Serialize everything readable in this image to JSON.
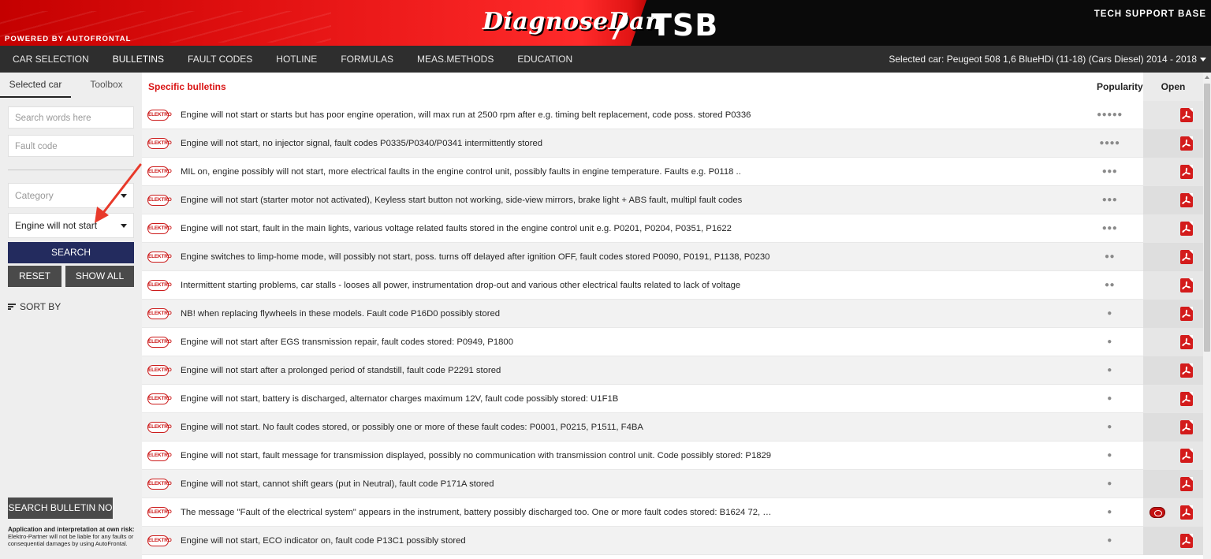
{
  "header": {
    "powered_by": "POWERED BY AUTOFRONTAL",
    "brand": "DiagnoseDan",
    "logo_tsb": "TSB",
    "tagline": "TECH SUPPORT BASE"
  },
  "nav": {
    "tabs": [
      "CAR SELECTION",
      "BULLETINS",
      "FAULT CODES",
      "HOTLINE",
      "FORMULAS",
      "MEAS.METHODS",
      "EDUCATION"
    ],
    "active": "BULLETINS",
    "selected_car": "Selected car: Peugeot 508 1,6 BlueHDi (11-18) (Cars Diesel) 2014 - 2018"
  },
  "sidebar": {
    "tab_selected_car": "Selected car",
    "tab_toolbox": "Toolbox",
    "search_placeholder": "Search words here",
    "faultcode_placeholder": "Fault code",
    "category_placeholder": "Category",
    "subcategory_value": "Engine will not start",
    "search_button": "SEARCH",
    "reset_button": "RESET",
    "showall_button": "SHOW ALL",
    "sort_by": "SORT BY",
    "search_bulletin_button": "SEARCH BULLETIN NO",
    "disclaimer_title": "Application and interpretation at own risk:",
    "disclaimer_text": "Elektro-Partner will not be liable for any faults or consequential damages by using AutoFrontal."
  },
  "table": {
    "title": "Specific bulletins",
    "col_popularity": "Popularity",
    "col_open": "Open",
    "source_badge": "ELEKTRO",
    "rows": [
      {
        "title": "Engine will not start or starts but has poor engine operation, will max run at 2500 rpm after e.g. timing belt replacement, code poss. stored P0336",
        "popularity": "●●●●●",
        "extra_icon": false
      },
      {
        "title": "Engine will not start, no injector signal, fault codes P0335/P0340/P0341 intermittently stored",
        "popularity": "●●●●",
        "extra_icon": false
      },
      {
        "title": "MIL on, engine possibly will not start, more electrical faults in the engine control unit, possibly faults in engine temperature. Faults e.g. P0118 ..",
        "popularity": "●●●",
        "extra_icon": false
      },
      {
        "title": "Engine will not start (starter motor not activated), Keyless start button not working, side-view mirrors, brake light + ABS fault, multipl fault codes",
        "popularity": "●●●",
        "extra_icon": false
      },
      {
        "title": "Engine will not start, fault in the main lights, various voltage related faults stored in the engine control unit e.g. P0201, P0204, P0351, P1622",
        "popularity": "●●●",
        "extra_icon": false
      },
      {
        "title": "Engine switches to limp-home mode, will possibly not start, poss. turns off delayed after ignition OFF, fault codes stored P0090, P0191, P1138, P0230",
        "popularity": "●●",
        "extra_icon": false
      },
      {
        "title": "Intermittent starting problems, car stalls - looses all power, instrumentation drop-out and various other electrical faults related to lack of voltage",
        "popularity": "●●",
        "extra_icon": false
      },
      {
        "title": "NB! when replacing flywheels in these models. Fault code P16D0 possibly stored",
        "popularity": "●",
        "extra_icon": false
      },
      {
        "title": "Engine will not start after EGS transmission repair, fault codes stored: P0949, P1800",
        "popularity": "●",
        "extra_icon": false
      },
      {
        "title": "Engine will not start after a prolonged period of standstill, fault code P2291 stored",
        "popularity": "●",
        "extra_icon": false
      },
      {
        "title": "Engine will not start, battery is discharged, alternator charges maximum 12V, fault code possibly stored: U1F1B",
        "popularity": "●",
        "extra_icon": false
      },
      {
        "title": "Engine will not start. No fault codes stored, or possibly one or more of these fault codes: P0001, P0215, P1511, F4BA",
        "popularity": "●",
        "extra_icon": false
      },
      {
        "title": "Engine will not start, fault message for transmission displayed, possibly no communication with transmission control unit. Code possibly stored: P1829",
        "popularity": "●",
        "extra_icon": false
      },
      {
        "title": "Engine will not start, cannot shift gears (put in Neutral), fault code P171A stored",
        "popularity": "●",
        "extra_icon": false
      },
      {
        "title": "The message \"Fault of the electrical system\" appears in the instrument, battery possibly discharged too. One or more fault codes stored: B1624 72, …",
        "popularity": "●",
        "extra_icon": true
      },
      {
        "title": "Engine will not start, ECO indicator on, fault code P13C1 possibly stored",
        "popularity": "●",
        "extra_icon": false
      }
    ]
  },
  "colors": {
    "brand_red": "#e01010",
    "nav_bg": "#2e2e2e",
    "search_button": "#232b5e",
    "accent_title": "#d91414"
  }
}
